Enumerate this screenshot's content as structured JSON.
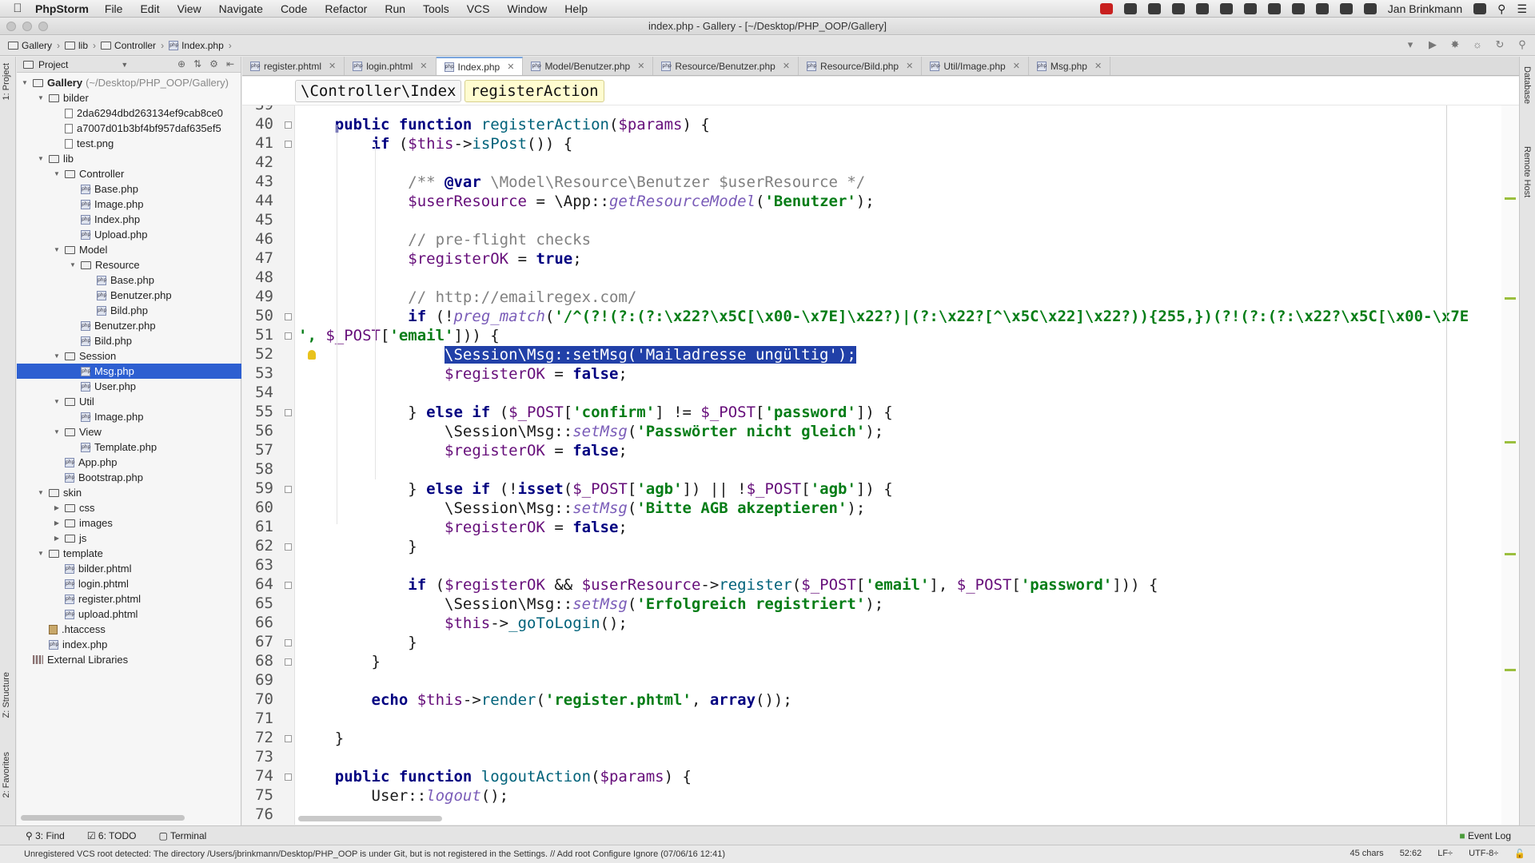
{
  "menubar": {
    "app": "PhpStorm",
    "items": [
      "File",
      "Edit",
      "View",
      "Navigate",
      "Code",
      "Refactor",
      "Run",
      "Tools",
      "VCS",
      "Window",
      "Help"
    ],
    "user": "Jan Brinkmann"
  },
  "window": {
    "title": "index.php - Gallery - [~/Desktop/PHP_OOP/Gallery]"
  },
  "navbar": {
    "crumbs": [
      "Gallery",
      "lib",
      "Controller",
      "Index.php"
    ]
  },
  "side": {
    "project": "1: Project",
    "structure": "Z: Structure",
    "favorites": "2: Favorites",
    "database": "Database",
    "remote": "Remote Host"
  },
  "project": {
    "header": "Project",
    "tree": [
      {
        "label": "Gallery",
        "extra": "(~/Desktop/PHP_OOP/Gallery)",
        "depth": 0,
        "type": "folder",
        "open": true
      },
      {
        "label": "bilder",
        "depth": 1,
        "type": "folder",
        "open": true
      },
      {
        "label": "2da6294dbd263134ef9cab8ce0",
        "depth": 2,
        "type": "file"
      },
      {
        "label": "a7007d01b3bf4bf957daf635ef5",
        "depth": 2,
        "type": "file"
      },
      {
        "label": "test.png",
        "depth": 2,
        "type": "file"
      },
      {
        "label": "lib",
        "depth": 1,
        "type": "folder",
        "open": true
      },
      {
        "label": "Controller",
        "depth": 2,
        "type": "folder",
        "open": true
      },
      {
        "label": "Base.php",
        "depth": 3,
        "type": "php"
      },
      {
        "label": "Image.php",
        "depth": 3,
        "type": "php"
      },
      {
        "label": "Index.php",
        "depth": 3,
        "type": "php"
      },
      {
        "label": "Upload.php",
        "depth": 3,
        "type": "php"
      },
      {
        "label": "Model",
        "depth": 2,
        "type": "folder",
        "open": true
      },
      {
        "label": "Resource",
        "depth": 3,
        "type": "folder",
        "open": true
      },
      {
        "label": "Base.php",
        "depth": 4,
        "type": "php"
      },
      {
        "label": "Benutzer.php",
        "depth": 4,
        "type": "php"
      },
      {
        "label": "Bild.php",
        "depth": 4,
        "type": "php"
      },
      {
        "label": "Benutzer.php",
        "depth": 3,
        "type": "php"
      },
      {
        "label": "Bild.php",
        "depth": 3,
        "type": "php"
      },
      {
        "label": "Session",
        "depth": 2,
        "type": "folder",
        "open": true
      },
      {
        "label": "Msg.php",
        "depth": 3,
        "type": "php",
        "selected": true
      },
      {
        "label": "User.php",
        "depth": 3,
        "type": "php"
      },
      {
        "label": "Util",
        "depth": 2,
        "type": "folder",
        "open": true
      },
      {
        "label": "Image.php",
        "depth": 3,
        "type": "php"
      },
      {
        "label": "View",
        "depth": 2,
        "type": "folder",
        "open": true
      },
      {
        "label": "Template.php",
        "depth": 3,
        "type": "php"
      },
      {
        "label": "App.php",
        "depth": 2,
        "type": "php"
      },
      {
        "label": "Bootstrap.php",
        "depth": 2,
        "type": "php"
      },
      {
        "label": "skin",
        "depth": 1,
        "type": "folder",
        "open": true
      },
      {
        "label": "css",
        "depth": 2,
        "type": "folder",
        "open": false
      },
      {
        "label": "images",
        "depth": 2,
        "type": "folder",
        "open": false
      },
      {
        "label": "js",
        "depth": 2,
        "type": "folder",
        "open": false
      },
      {
        "label": "template",
        "depth": 1,
        "type": "folder",
        "open": true
      },
      {
        "label": "bilder.phtml",
        "depth": 2,
        "type": "php"
      },
      {
        "label": "login.phtml",
        "depth": 2,
        "type": "php"
      },
      {
        "label": "register.phtml",
        "depth": 2,
        "type": "php"
      },
      {
        "label": "upload.phtml",
        "depth": 2,
        "type": "php"
      },
      {
        "label": ".htaccess",
        "depth": 1,
        "type": "hta"
      },
      {
        "label": "index.php",
        "depth": 1,
        "type": "php"
      },
      {
        "label": "External Libraries",
        "depth": 0,
        "type": "lib"
      }
    ]
  },
  "tabs": [
    {
      "label": "register.phtml",
      "active": false
    },
    {
      "label": "login.phtml",
      "active": false
    },
    {
      "label": "Index.php",
      "active": true
    },
    {
      "label": "Model/Benutzer.php",
      "active": false
    },
    {
      "label": "Resource/Benutzer.php",
      "active": false
    },
    {
      "label": "Resource/Bild.php",
      "active": false
    },
    {
      "label": "Util/Image.php",
      "active": false
    },
    {
      "label": "Msg.php",
      "active": false
    }
  ],
  "editor_crumbs": [
    "\\Controller\\Index",
    "registerAction"
  ],
  "code": {
    "first_line": 39,
    "lines": [
      [
        [
          "",
          ""
        ]
      ],
      [
        [
          "    ",
          ""
        ],
        [
          "public function ",
          "kw"
        ],
        [
          "registerAction",
          "fn"
        ],
        [
          "(",
          ""
        ],
        [
          "$params",
          "var"
        ],
        [
          ") {",
          ""
        ]
      ],
      [
        [
          "        ",
          ""
        ],
        [
          "if ",
          "kw"
        ],
        [
          "(",
          ""
        ],
        [
          "$this",
          "var"
        ],
        [
          "->",
          ""
        ],
        [
          "isPost",
          "fn"
        ],
        [
          "()) {",
          ""
        ]
      ],
      [
        [
          "",
          ""
        ]
      ],
      [
        [
          "            ",
          ""
        ],
        [
          "/** ",
          "cmt"
        ],
        [
          "@var",
          "kw"
        ],
        [
          " \\Model\\Resource\\Benutzer $userResource */",
          "cmt"
        ]
      ],
      [
        [
          "            ",
          ""
        ],
        [
          "$userResource",
          "var"
        ],
        [
          " = \\App::",
          ""
        ],
        [
          "getResourceModel",
          "meth"
        ],
        [
          "(",
          ""
        ],
        [
          "'Benutzer'",
          "str"
        ],
        [
          ");",
          ""
        ]
      ],
      [
        [
          "",
          ""
        ]
      ],
      [
        [
          "            ",
          ""
        ],
        [
          "// pre-flight checks",
          "cmt"
        ]
      ],
      [
        [
          "            ",
          ""
        ],
        [
          "$registerOK",
          "var"
        ],
        [
          " = ",
          ""
        ],
        [
          "true",
          "kw"
        ],
        [
          ";",
          ""
        ]
      ],
      [
        [
          "",
          ""
        ]
      ],
      [
        [
          "            ",
          ""
        ],
        [
          "// http://emailregex.com/",
          "cmt"
        ]
      ],
      [
        [
          "            ",
          ""
        ],
        [
          "if ",
          "kw"
        ],
        [
          "(!",
          ""
        ],
        [
          "preg_match",
          "meth"
        ],
        [
          "(",
          ""
        ],
        [
          "'/^(?!(?:(?:\\x22?\\x5C[\\x00-\\x7E]\\x22?)|(?:\\x22?[^\\x5C\\x22]\\x22?)){255,})(?!(?:(?:\\x22?\\x5C[\\x00-\\x7E",
          "str"
        ]
      ],
      [
        [
          "', ",
          "str"
        ],
        [
          "$_POST",
          "var"
        ],
        [
          "[",
          ""
        ],
        [
          "'email'",
          "str"
        ],
        [
          "])) {",
          ""
        ]
      ],
      [
        [
          "                ",
          ""
        ],
        [
          "\\Session\\Msg::setMsg('Mailadresse ungültig');",
          "sel-txt"
        ]
      ],
      [
        [
          "                ",
          ""
        ],
        [
          "$registerOK",
          "var"
        ],
        [
          " = ",
          ""
        ],
        [
          "false",
          "kw"
        ],
        [
          ";",
          ""
        ]
      ],
      [
        [
          "",
          ""
        ]
      ],
      [
        [
          "            ",
          ""
        ],
        [
          "} ",
          ""
        ],
        [
          "else if ",
          "kw"
        ],
        [
          "(",
          ""
        ],
        [
          "$_POST",
          "var"
        ],
        [
          "[",
          ""
        ],
        [
          "'confirm'",
          "str"
        ],
        [
          "] != ",
          ""
        ],
        [
          "$_POST",
          "var"
        ],
        [
          "[",
          ""
        ],
        [
          "'password'",
          "str"
        ],
        [
          "]) {",
          ""
        ]
      ],
      [
        [
          "                ",
          ""
        ],
        [
          "\\Session\\Msg::",
          ""
        ],
        [
          "setMsg",
          "meth"
        ],
        [
          "(",
          ""
        ],
        [
          "'Passwörter nicht gleich'",
          "str"
        ],
        [
          ");",
          ""
        ]
      ],
      [
        [
          "                ",
          ""
        ],
        [
          "$registerOK",
          "var"
        ],
        [
          " = ",
          ""
        ],
        [
          "false",
          "kw"
        ],
        [
          ";",
          ""
        ]
      ],
      [
        [
          "",
          ""
        ]
      ],
      [
        [
          "            ",
          ""
        ],
        [
          "} ",
          ""
        ],
        [
          "else if ",
          "kw"
        ],
        [
          "(!",
          ""
        ],
        [
          "isset",
          "kw"
        ],
        [
          "(",
          ""
        ],
        [
          "$_POST",
          "var"
        ],
        [
          "[",
          ""
        ],
        [
          "'agb'",
          "str"
        ],
        [
          "]) || !",
          ""
        ],
        [
          "$_POST",
          "var"
        ],
        [
          "[",
          ""
        ],
        [
          "'agb'",
          "str"
        ],
        [
          "]) {",
          ""
        ]
      ],
      [
        [
          "                ",
          ""
        ],
        [
          "\\Session\\Msg::",
          ""
        ],
        [
          "setMsg",
          "meth"
        ],
        [
          "(",
          ""
        ],
        [
          "'Bitte AGB akzeptieren'",
          "str"
        ],
        [
          ");",
          ""
        ]
      ],
      [
        [
          "                ",
          ""
        ],
        [
          "$registerOK",
          "var"
        ],
        [
          " = ",
          ""
        ],
        [
          "false",
          "kw"
        ],
        [
          ";",
          ""
        ]
      ],
      [
        [
          "            ",
          ""
        ],
        [
          "}",
          ""
        ]
      ],
      [
        [
          "",
          ""
        ]
      ],
      [
        [
          "            ",
          ""
        ],
        [
          "if ",
          "kw"
        ],
        [
          "(",
          ""
        ],
        [
          "$registerOK",
          "var"
        ],
        [
          " && ",
          ""
        ],
        [
          "$userResource",
          "var"
        ],
        [
          "->",
          ""
        ],
        [
          "register",
          "fn"
        ],
        [
          "(",
          ""
        ],
        [
          "$_POST",
          "var"
        ],
        [
          "[",
          ""
        ],
        [
          "'email'",
          "str"
        ],
        [
          "], ",
          ""
        ],
        [
          "$_POST",
          "var"
        ],
        [
          "[",
          ""
        ],
        [
          "'password'",
          "str"
        ],
        [
          "])) {",
          ""
        ]
      ],
      [
        [
          "                ",
          ""
        ],
        [
          "\\Session\\Msg::",
          ""
        ],
        [
          "setMsg",
          "meth"
        ],
        [
          "(",
          ""
        ],
        [
          "'Erfolgreich registriert'",
          "str"
        ],
        [
          ");",
          ""
        ]
      ],
      [
        [
          "                ",
          ""
        ],
        [
          "$this",
          "var"
        ],
        [
          "->",
          ""
        ],
        [
          "_goToLogin",
          "fn"
        ],
        [
          "();",
          ""
        ]
      ],
      [
        [
          "            ",
          ""
        ],
        [
          "}",
          ""
        ]
      ],
      [
        [
          "        ",
          ""
        ],
        [
          "}",
          ""
        ]
      ],
      [
        [
          "",
          ""
        ]
      ],
      [
        [
          "        ",
          ""
        ],
        [
          "echo ",
          "kw"
        ],
        [
          "$this",
          "var"
        ],
        [
          "->",
          ""
        ],
        [
          "render",
          "fn"
        ],
        [
          "(",
          ""
        ],
        [
          "'register.phtml'",
          "str"
        ],
        [
          ", ",
          ""
        ],
        [
          "array",
          "kw"
        ],
        [
          "());",
          ""
        ]
      ],
      [
        [
          "",
          ""
        ]
      ],
      [
        [
          "    ",
          ""
        ],
        [
          "}",
          ""
        ]
      ],
      [
        [
          "",
          ""
        ]
      ],
      [
        [
          "    ",
          ""
        ],
        [
          "public function ",
          "kw"
        ],
        [
          "logoutAction",
          "fn"
        ],
        [
          "(",
          ""
        ],
        [
          "$params",
          "var"
        ],
        [
          ") {",
          ""
        ]
      ],
      [
        [
          "        ",
          ""
        ],
        [
          "User::",
          ""
        ],
        [
          "logout",
          "meth"
        ],
        [
          "();",
          ""
        ]
      ],
      [
        [
          "",
          ""
        ]
      ]
    ]
  },
  "bottom": {
    "find": "3: Find",
    "todo": "6: TODO",
    "terminal": "Terminal",
    "eventlog": "Event Log"
  },
  "status": {
    "message": "Unregistered VCS root detected: The directory /Users/jbrinkmann/Desktop/PHP_OOP is under Git, but is not registered in the Settings. // Add root  Configure  Ignore (07/06/16 12:41)",
    "chars": "45 chars",
    "position": "52:62",
    "line_sep": "LF÷",
    "encoding": "UTF-8÷"
  }
}
